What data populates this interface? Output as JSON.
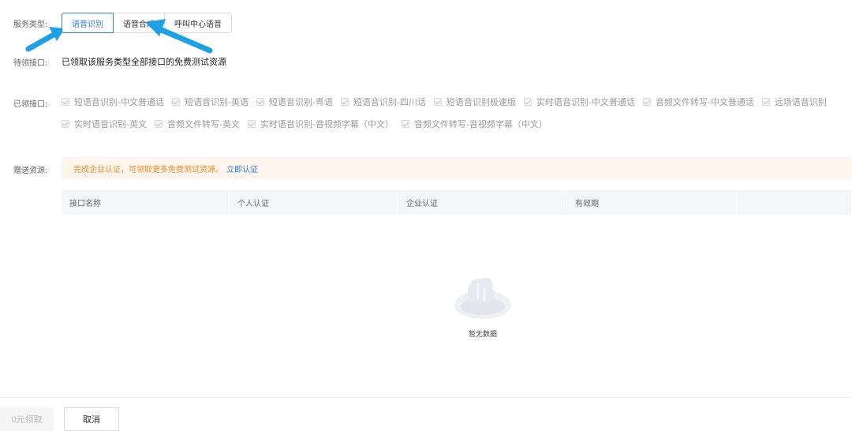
{
  "service_type": {
    "label": "服务类型:",
    "options": [
      {
        "label": "语音识别",
        "active": true
      },
      {
        "label": "语音合成",
        "active": false
      },
      {
        "label": "呼叫中心语音",
        "active": false
      }
    ]
  },
  "pending": {
    "label": "待领接口:",
    "text": "已领取该服务类型全部接口的免费测试资源"
  },
  "claimed": {
    "label": "已领接口:",
    "rows": [
      [
        "短语音识别-中文普通话",
        "短语音识别-英语",
        "短语音识别-粤语",
        "短语音识别-四川话",
        "短语音识别极速版",
        "实时语音识别-中文普通话",
        "音频文件转写-中文普通话",
        "远场语音识别"
      ],
      [
        "实时语音识别-英文",
        "音频文件转写-英文",
        "实时语音识别-音视频字幕（中文）",
        "音频文件转写-音视频字幕（中文）"
      ]
    ]
  },
  "gift": {
    "label": "赠送资源:",
    "notice": "完成企业认证，可领取更多免费测试资源。",
    "link": "立即认证"
  },
  "table": {
    "headers": [
      "接口名称",
      "个人认证",
      "企业认证",
      "有效期",
      ""
    ],
    "empty_text": "暂无数据"
  },
  "footer": {
    "claim_label": "0元领取",
    "cancel_label": "取消"
  },
  "colors": {
    "accent": "#2f7be8",
    "notice_text": "#f08c2b",
    "notice_bg": "#fdf5ec",
    "arrow": "#1ea0e6"
  }
}
